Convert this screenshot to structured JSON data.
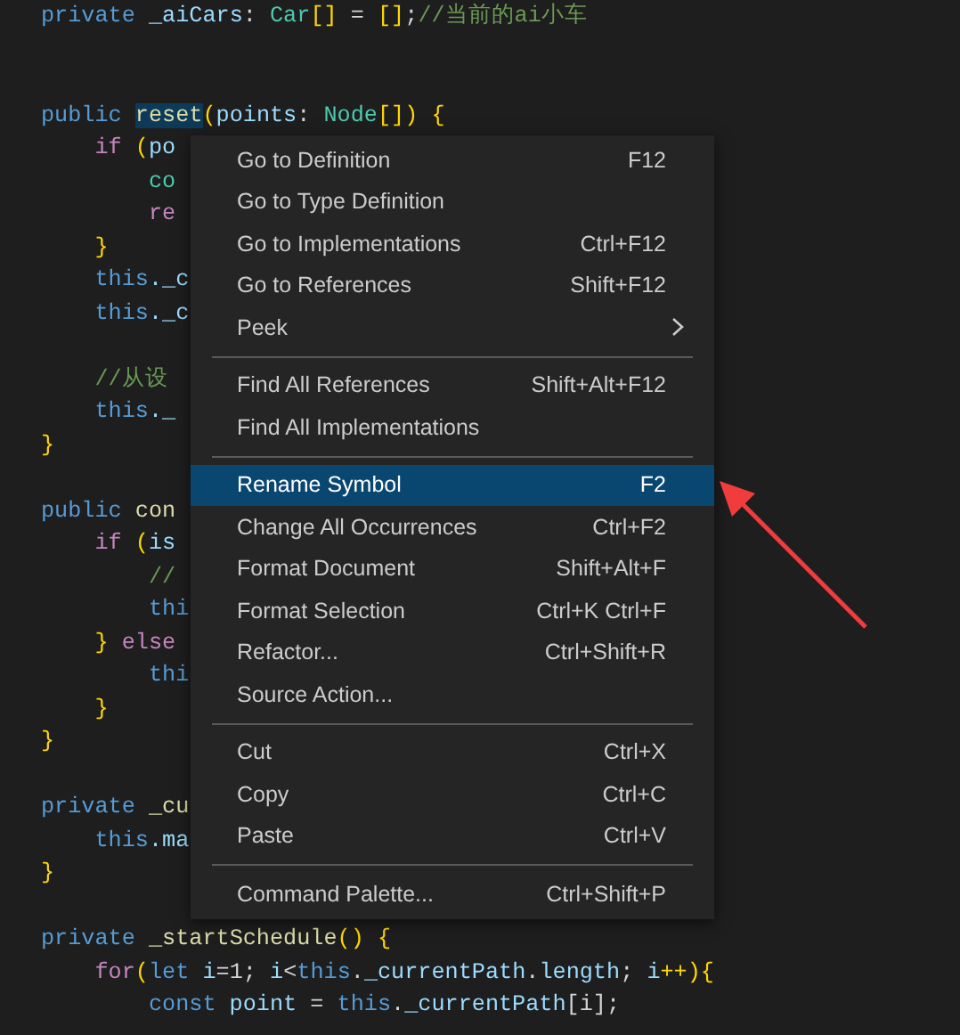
{
  "editor": {
    "lines": [
      {
        "kind": "code",
        "tokens": [
          {
            "text": "private ",
            "kind": "keyword"
          },
          {
            "text": "_aiCars",
            "kind": "property"
          },
          {
            "text": ": ",
            "kind": "plain"
          },
          {
            "text": "Car",
            "kind": "type"
          },
          {
            "text": "[]",
            "kind": "bracket"
          },
          {
            "text": " = ",
            "kind": "plain"
          },
          {
            "text": "[]",
            "kind": "bracket"
          },
          {
            "text": ";",
            "kind": "plain"
          },
          {
            "text": "//当前的ai小车",
            "kind": "comment"
          }
        ]
      },
      {
        "kind": "blank"
      },
      {
        "kind": "blank"
      },
      {
        "kind": "code",
        "tokens": [
          {
            "text": "public ",
            "kind": "keyword"
          },
          {
            "text": "reset",
            "kind": "highlight"
          },
          {
            "text": "(",
            "kind": "bracket"
          },
          {
            "text": "points",
            "kind": "property"
          },
          {
            "text": ": ",
            "kind": "plain"
          },
          {
            "text": "Node",
            "kind": "type"
          },
          {
            "text": "[]",
            "kind": "bracket"
          },
          {
            "text": ") ",
            "kind": "bracket"
          },
          {
            "text": "{",
            "kind": "bracket"
          }
        ]
      },
      {
        "kind": "code",
        "tokens": [
          {
            "text": "    if",
            "kind": "control"
          },
          {
            "text": " (",
            "kind": "bracket"
          },
          {
            "text": "po",
            "kind": "property"
          }
        ]
      },
      {
        "kind": "code",
        "tokens": [
          {
            "text": "        co",
            "kind": "type"
          }
        ]
      },
      {
        "kind": "code",
        "tokens": [
          {
            "text": "        re",
            "kind": "control"
          }
        ]
      },
      {
        "kind": "code",
        "tokens": [
          {
            "text": "    }",
            "kind": "bracket"
          }
        ]
      },
      {
        "kind": "code",
        "tokens": [
          {
            "text": "    this",
            "kind": "keyword"
          },
          {
            "text": "._c",
            "kind": "property"
          }
        ]
      },
      {
        "kind": "code",
        "tokens": [
          {
            "text": "    this",
            "kind": "keyword"
          },
          {
            "text": "._c",
            "kind": "property"
          }
        ]
      },
      {
        "kind": "blank"
      },
      {
        "kind": "code",
        "tokens": [
          {
            "text": "    //从设",
            "kind": "comment"
          }
        ]
      },
      {
        "kind": "code",
        "tokens": [
          {
            "text": "    this",
            "kind": "keyword"
          },
          {
            "text": "._",
            "kind": "property"
          }
        ]
      },
      {
        "kind": "code",
        "tokens": [
          {
            "text": "}",
            "kind": "bracket"
          }
        ]
      },
      {
        "kind": "blank"
      },
      {
        "kind": "code",
        "tokens": [
          {
            "text": "public ",
            "kind": "keyword"
          },
          {
            "text": "con",
            "kind": "function"
          }
        ]
      },
      {
        "kind": "code",
        "tokens": [
          {
            "text": "    if",
            "kind": "control"
          },
          {
            "text": " (",
            "kind": "bracket"
          },
          {
            "text": "is",
            "kind": "property"
          }
        ]
      },
      {
        "kind": "code",
        "tokens": [
          {
            "text": "        //",
            "kind": "comment"
          }
        ]
      },
      {
        "kind": "code",
        "tokens": [
          {
            "text": "        thi",
            "kind": "keyword"
          }
        ]
      },
      {
        "kind": "code",
        "tokens": [
          {
            "text": "    }",
            "kind": "bracket"
          },
          {
            "text": " else",
            "kind": "control"
          }
        ]
      },
      {
        "kind": "code",
        "tokens": [
          {
            "text": "        thi",
            "kind": "keyword"
          }
        ]
      },
      {
        "kind": "code",
        "tokens": [
          {
            "text": "    }",
            "kind": "bracket"
          }
        ]
      },
      {
        "kind": "code",
        "tokens": [
          {
            "text": "}",
            "kind": "bracket"
          }
        ]
      },
      {
        "kind": "blank"
      },
      {
        "kind": "code",
        "tokens": [
          {
            "text": "private ",
            "kind": "keyword"
          },
          {
            "text": "_cu",
            "kind": "function"
          }
        ]
      },
      {
        "kind": "code",
        "tokens": [
          {
            "text": "    this",
            "kind": "keyword"
          },
          {
            "text": ".ma",
            "kind": "property"
          }
        ]
      },
      {
        "kind": "code",
        "tokens": [
          {
            "text": "}",
            "kind": "bracket"
          }
        ]
      },
      {
        "kind": "blank"
      },
      {
        "kind": "code",
        "tokens": [
          {
            "text": "private ",
            "kind": "keyword"
          },
          {
            "text": "_startSchedule",
            "kind": "function"
          },
          {
            "text": "() ",
            "kind": "bracket"
          },
          {
            "text": "{",
            "kind": "bracket"
          }
        ]
      },
      {
        "kind": "code",
        "tokens": [
          {
            "text": "    for",
            "kind": "control"
          },
          {
            "text": "(",
            "kind": "bracket"
          },
          {
            "text": "let",
            "kind": "keyword"
          },
          {
            "text": " i",
            "kind": "property"
          },
          {
            "text": "=1; ",
            "kind": "plain"
          },
          {
            "text": "i",
            "kind": "property"
          },
          {
            "text": "<",
            "kind": "plain"
          },
          {
            "text": "this",
            "kind": "keyword"
          },
          {
            "text": ".",
            "kind": "plain"
          },
          {
            "text": "_currentPath",
            "kind": "property"
          },
          {
            "text": ".",
            "kind": "plain"
          },
          {
            "text": "length",
            "kind": "property"
          },
          {
            "text": "; ",
            "kind": "plain"
          },
          {
            "text": "i",
            "kind": "property"
          },
          {
            "text": "++){",
            "kind": "bracket"
          }
        ]
      },
      {
        "kind": "code",
        "tokens": [
          {
            "text": "        const",
            "kind": "keyword"
          },
          {
            "text": " point",
            "kind": "property"
          },
          {
            "text": " = ",
            "kind": "plain"
          },
          {
            "text": "this",
            "kind": "keyword"
          },
          {
            "text": ".",
            "kind": "plain"
          },
          {
            "text": "_currentPath",
            "kind": "property"
          },
          {
            "text": "[i];",
            "kind": "plain"
          }
        ]
      }
    ]
  },
  "context_menu": {
    "items": [
      {
        "kind": "item",
        "label": "Go to Definition",
        "shortcut": "F12",
        "submenu": false,
        "selected": false
      },
      {
        "kind": "item",
        "label": "Go to Type Definition",
        "submenu": false,
        "selected": false
      },
      {
        "kind": "item",
        "label": "Go to Implementations",
        "shortcut": "Ctrl+F12",
        "submenu": false,
        "selected": false
      },
      {
        "kind": "item",
        "label": "Go to References",
        "shortcut": "Shift+F12",
        "submenu": false,
        "selected": false
      },
      {
        "kind": "item",
        "label": "Peek",
        "submenu": true,
        "selected": false
      },
      {
        "kind": "separator"
      },
      {
        "kind": "item",
        "label": "Find All References",
        "shortcut": "Shift+Alt+F12",
        "submenu": false,
        "selected": false
      },
      {
        "kind": "item",
        "label": "Find All Implementations",
        "submenu": false,
        "selected": false
      },
      {
        "kind": "separator"
      },
      {
        "kind": "item",
        "label": "Rename Symbol",
        "shortcut": "F2",
        "submenu": false,
        "selected": true
      },
      {
        "kind": "item",
        "label": "Change All Occurrences",
        "shortcut": "Ctrl+F2",
        "submenu": false,
        "selected": false
      },
      {
        "kind": "item",
        "label": "Format Document",
        "shortcut": "Shift+Alt+F",
        "submenu": false,
        "selected": false
      },
      {
        "kind": "item",
        "label": "Format Selection",
        "shortcut": "Ctrl+K Ctrl+F",
        "submenu": false,
        "selected": false
      },
      {
        "kind": "item",
        "label": "Refactor...",
        "shortcut": "Ctrl+Shift+R",
        "submenu": false,
        "selected": false
      },
      {
        "kind": "item",
        "label": "Source Action...",
        "submenu": false,
        "selected": false
      },
      {
        "kind": "separator"
      },
      {
        "kind": "item",
        "label": "Cut",
        "shortcut": "Ctrl+X",
        "submenu": false,
        "selected": false
      },
      {
        "kind": "item",
        "label": "Copy",
        "shortcut": "Ctrl+C",
        "submenu": false,
        "selected": false
      },
      {
        "kind": "item",
        "label": "Paste",
        "shortcut": "Ctrl+V",
        "submenu": false,
        "selected": false
      },
      {
        "kind": "separator"
      },
      {
        "kind": "item",
        "label": "Command Palette...",
        "shortcut": "Ctrl+Shift+P",
        "submenu": false,
        "selected": false
      }
    ]
  }
}
